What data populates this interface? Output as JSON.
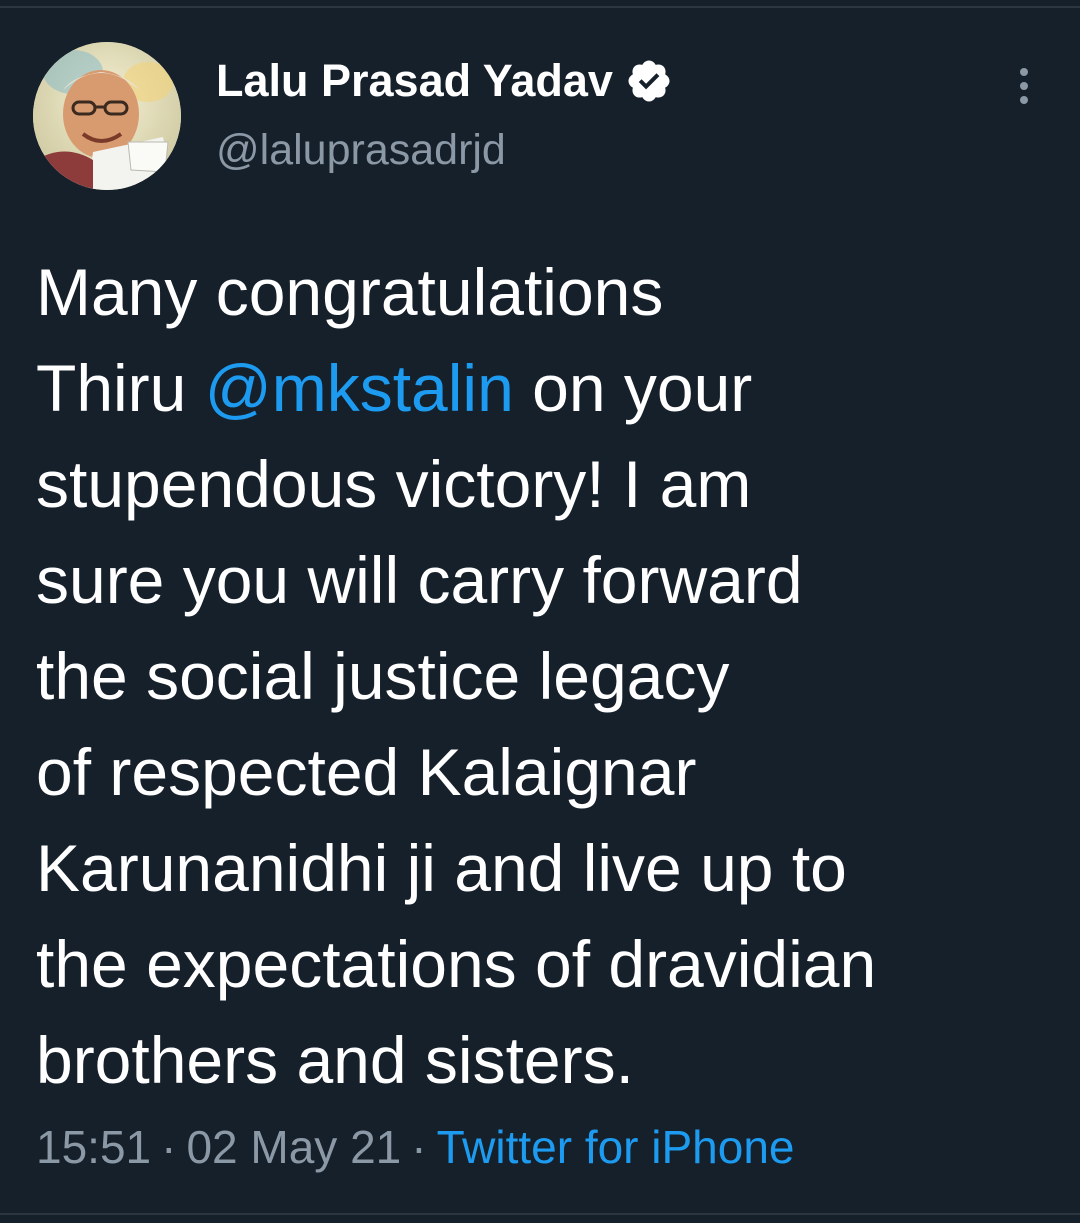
{
  "author": {
    "display_name": "Lalu Prasad Yadav",
    "handle": "@laluprasadrjd",
    "verified": true
  },
  "tweet": {
    "lines": [
      [
        {
          "text": "Many congratulations"
        }
      ],
      [
        {
          "text": "Thiru "
        },
        {
          "text": "@mkstalin",
          "mention": true
        },
        {
          "text": " on your"
        }
      ],
      [
        {
          "text": "stupendous victory! I am"
        }
      ],
      [
        {
          "text": "sure you will carry forward"
        }
      ],
      [
        {
          "text": "the social justice legacy"
        }
      ],
      [
        {
          "text": "of respected Kalaignar"
        }
      ],
      [
        {
          "text": "Karunanidhi ji and live up to"
        }
      ],
      [
        {
          "text": "the expectations of dravidian"
        }
      ],
      [
        {
          "text": "brothers and sisters."
        }
      ]
    ]
  },
  "meta": {
    "time": "15:51",
    "separator": "·",
    "date": "02 May 21",
    "source": "Twitter for iPhone"
  },
  "icons": {
    "verified": "verified-badge-icon",
    "more": "more-vertical-icon"
  },
  "colors": {
    "background": "#16202b",
    "text": "#ffffff",
    "secondary_text": "#8b98a5",
    "link": "#1d9bf0",
    "divider": "#2b3640"
  }
}
